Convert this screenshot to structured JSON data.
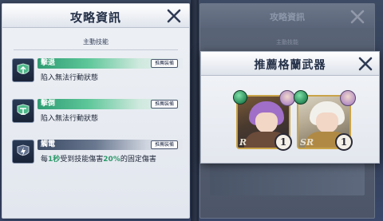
{
  "left_panel": {
    "title": "攻略資訊",
    "section_label": "主動技能",
    "skills": [
      {
        "name": "擊退",
        "badge": "推薦裝備",
        "description": "陷入無法行動狀態",
        "style": "green"
      },
      {
        "name": "擊倒",
        "badge": "推薦裝備",
        "description": "陷入無法行動狀態",
        "style": "green"
      },
      {
        "name": "觸電",
        "badge": "推薦裝備",
        "description_parts": [
          "每",
          "1秒",
          "受到技能傷害",
          "20%",
          "的固定傷害"
        ],
        "style": "grey"
      }
    ]
  },
  "popup": {
    "title": "推薦格蘭武器",
    "weapons": [
      {
        "rarity": "R",
        "level": "1",
        "element": "wind",
        "hair_color": "#a06fc7"
      },
      {
        "rarity": "SR",
        "level": "1",
        "element": "wind",
        "hair_color": "#f2f0ea"
      }
    ]
  },
  "background_panel": {
    "title": "攻略資訊",
    "subtitle": "主動技能"
  },
  "colors": {
    "accent_green": "#2e9a6c",
    "title_text": "#243048",
    "gold_border": "#c9a44a"
  },
  "icons": [
    "close-icon",
    "skill-knockback-icon",
    "skill-knockdown-icon",
    "skill-shock-icon",
    "wind-element-icon"
  ]
}
